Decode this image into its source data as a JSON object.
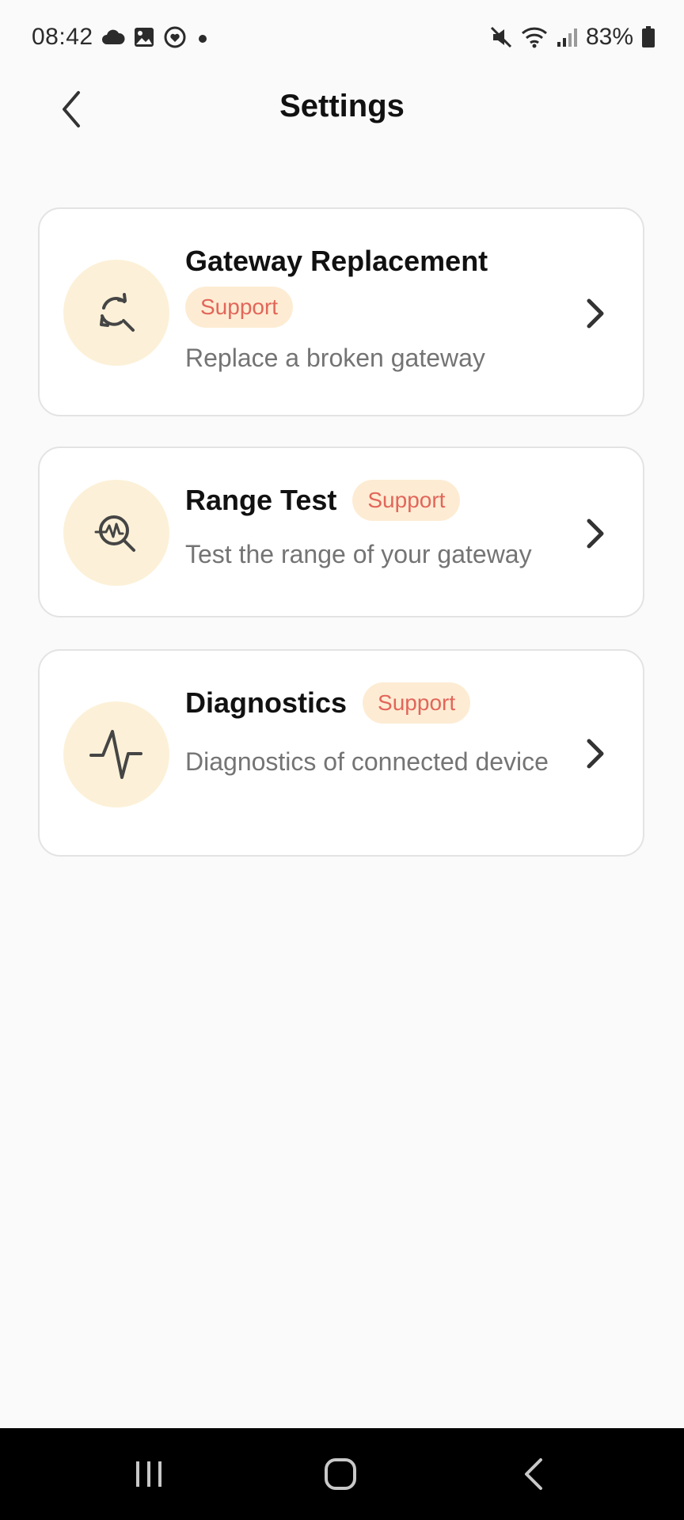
{
  "status_bar": {
    "time": "08:42",
    "battery": "83%",
    "left_icons": [
      "cloud-icon",
      "gallery-icon",
      "heart-sync-icon",
      "dot-icon"
    ],
    "right_icons": [
      "mute-icon",
      "wifi-icon",
      "signal-icon",
      "battery-icon"
    ]
  },
  "header": {
    "title": "Settings",
    "back_icon": "chevron-left-icon"
  },
  "items": [
    {
      "title": "Gateway Replacement",
      "badge": "Support",
      "description": "Replace a broken gateway",
      "icon": "replace-search-icon"
    },
    {
      "title": "Range Test",
      "badge": "Support",
      "description": "Test the range of your gateway",
      "icon": "range-search-icon"
    },
    {
      "title": "Diagnostics",
      "badge": "Support",
      "description": "Diagnostics of connected device",
      "icon": "pulse-icon"
    }
  ],
  "nav_bar": {
    "buttons": [
      "recent-apps-icon",
      "home-icon",
      "back-icon"
    ]
  },
  "colors": {
    "background": "#fafafa",
    "icon_circle": "#fcf1d8",
    "badge_bg": "#fdecd3",
    "badge_text": "#e2665a",
    "description": "#747474"
  }
}
